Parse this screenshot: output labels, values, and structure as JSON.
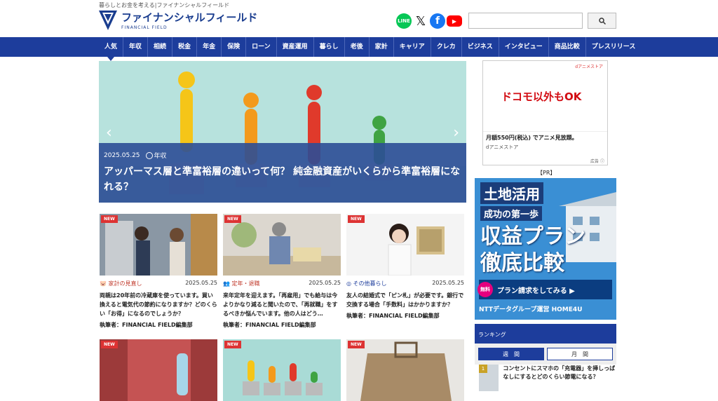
{
  "header": {
    "tagline": "暮らしとお金を考える|ファイナンシャルフィールド",
    "logo_text": "ファイナンシャルフィールド",
    "logo_sub": "FINANCIAL FIELD",
    "social_icons": [
      "line-icon",
      "x-icon",
      "facebook-icon",
      "youtube-icon"
    ],
    "search_icon": "search-icon"
  },
  "nav": [
    "人気",
    "年収",
    "相続",
    "税金",
    "年金",
    "保険",
    "ローン",
    "資産運用",
    "暮らし",
    "老後",
    "家計",
    "キャリア",
    "クレカ",
    "ビジネス",
    "インタビュー",
    "商品比較",
    "プレスリリース"
  ],
  "hero": {
    "date": "2025.05.25",
    "category": "年収",
    "title": "アッパーマス層と準富裕層の違いって何？ 純金融資産がいくらから準富裕層になれる？"
  },
  "cards": [
    {
      "badge": "NEW",
      "category": "家計の見直し",
      "date": "2025.05.25",
      "title": "両親は20年前の冷蔵庫を使っています。買い換えると電気代の節約になりますか？どのくらい「お得」になるのでしょうか？",
      "author": "執筆者：FINANCIAL FIELD編集部"
    },
    {
      "badge": "NEW",
      "category": "定年・退職",
      "date": "2025.05.25",
      "title": "来年定年を迎えます。「再雇用」でも給与は今よりかなり減ると聞いたので、「再就職」をするべきか悩んでいます。他の人はどう…",
      "author": "執筆者：FINANCIAL FIELD編集部"
    },
    {
      "badge": "NEW",
      "category": "その他暮らし",
      "date": "2025.05.25",
      "title": "友人の結婚式で「ピン札」が必要です。銀行で交換する場合「手数料」はかかりますか？",
      "author": "執筆者：FINANCIAL FIELD編集部"
    },
    {
      "badge": "NEW"
    },
    {
      "badge": "NEW"
    },
    {
      "badge": "NEW"
    }
  ],
  "sidebar": {
    "ad1_top": "dアニメストア",
    "ad1_main": "ドコモ以外もOK",
    "ad1_text": "月額550円(税込) でアニメ見放題。",
    "ad1_sub": "dアニメストア",
    "ad1_label": "広告",
    "pr_label": "【PR】",
    "ad2_title": "土地活用",
    "ad2_sub": "成功の第一歩",
    "ad2_big_1": "収益プラン",
    "ad2_big_2": "徹底比較",
    "ad2_free": "無料",
    "ad2_cta": "プラン請求をしてみる ▶",
    "ad2_foot": "NTTデータグループ運営 HOME4U",
    "ranking_title": "ランキング",
    "tab_week": "週　間",
    "tab_month": "月　間",
    "rank1_num": "1",
    "rank1_title": "コンセントにスマホの「充電器」を挿しっぱなしにするとどのくらい節電になる？"
  }
}
